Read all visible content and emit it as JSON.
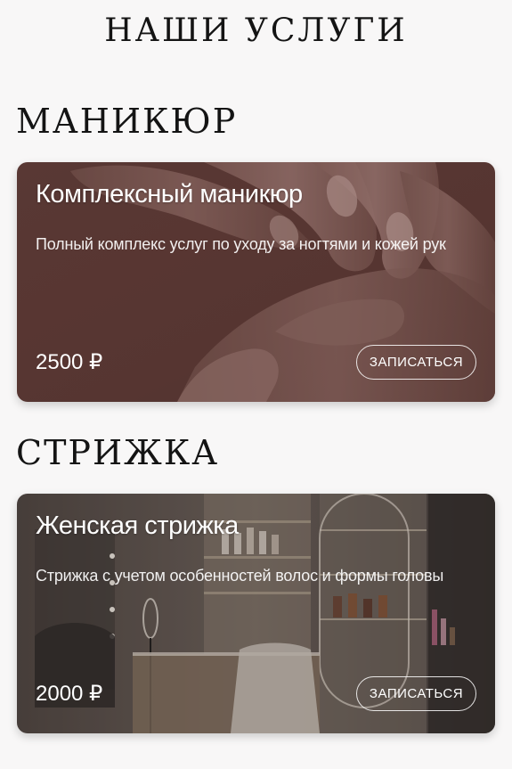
{
  "page_title": "НАШИ УСЛУГИ",
  "sections": [
    {
      "title": "МАНИКЮР",
      "card": {
        "title": "Комплексный маникюр",
        "description": "Полный комплекс услуг по уходу за ногтями и кожей рук",
        "price": "2500 ₽",
        "button": "ЗАПИСАТЬСЯ"
      }
    },
    {
      "title": "СТРИЖКА",
      "card": {
        "title": "Женская стрижка",
        "description": "Стрижка с учетом особенностей волос и формы головы",
        "price": "2000 ₽",
        "button": "ЗАПИСАТЬСЯ"
      }
    }
  ],
  "colors": {
    "background": "#f8f7f7",
    "heading": "#141414",
    "manicure_card": "#5a3a36",
    "haircut_card": "#5e5550"
  }
}
